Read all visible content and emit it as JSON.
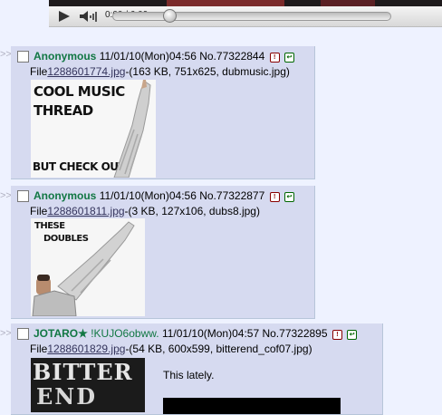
{
  "player": {
    "time": "0:00 / 6:09"
  },
  "posts": [
    {
      "name": "Anonymous",
      "datetime": "11/01/10(Mon)04:56",
      "number": "No.77322844",
      "file_prefix": "File",
      "file_link": "1288601774.jpg",
      "file_info": "-(163 KB, 751x625, dubmusic.jpg)",
      "image_text": [
        "COOL MUSIC",
        "THREAD",
        "BUT CHECK OUT"
      ]
    },
    {
      "name": "Anonymous",
      "datetime": "11/01/10(Mon)04:56",
      "number": "No.77322877",
      "file_prefix": "File",
      "file_link": "1288601811.jpg",
      "file_info": "-(3 KB, 127x106, dubs8.jpg)",
      "image_text": [
        "THESE",
        "DOUBLES"
      ]
    },
    {
      "name": "JOTARO★",
      "tripcode": "!KUJO6obww.",
      "datetime": "11/01/10(Mon)04:57",
      "number": "No.77322895",
      "file_prefix": "File",
      "file_link": "1288601829.jpg",
      "file_info": "-(54 KB, 600x599, bitterend_cof07.jpg)",
      "image_text": [
        "BITTER",
        "END"
      ],
      "comment": "This lately."
    }
  ],
  "icons": {
    "report": "!",
    "reply": "↩"
  }
}
